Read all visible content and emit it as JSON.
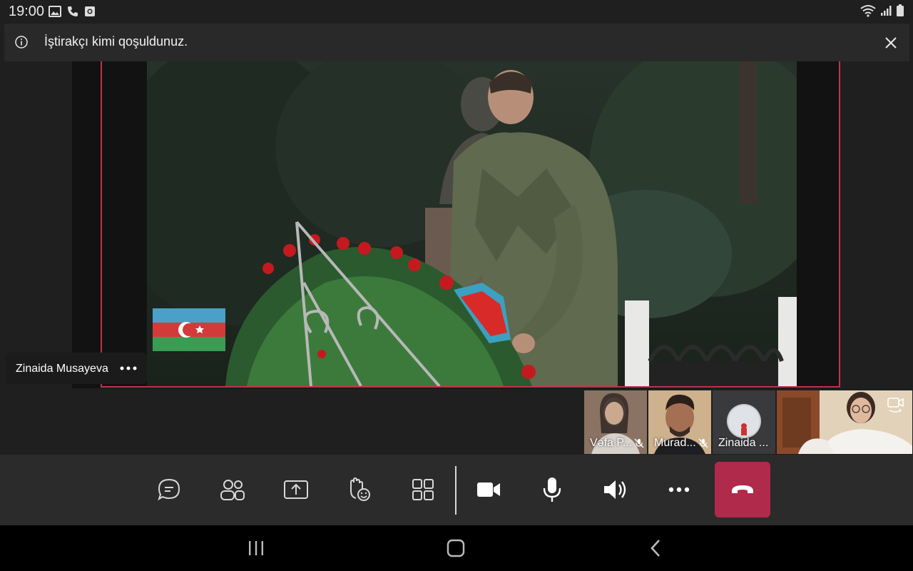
{
  "status_bar": {
    "time": "19:00",
    "left_icons": [
      "image-icon",
      "phone-icon",
      "screen-record-icon"
    ],
    "right_icons": [
      "wifi-icon",
      "signal-icon",
      "battery-icon"
    ]
  },
  "banner": {
    "text": "İştirakçı kimi qoşuldunuz.",
    "info_icon": "info-icon",
    "close_icon": "close-icon"
  },
  "main_video": {
    "presenter_name": "Zinaida Musayeva",
    "more_icon": "more-options-icon"
  },
  "participants": [
    {
      "label": "Vəfa P...",
      "muted": true
    },
    {
      "label": "Murad...",
      "muted": true
    },
    {
      "label": "Zinaida ...",
      "muted": false
    },
    {
      "label": "",
      "is_self": true,
      "switch_camera_icon": "switch-camera-icon"
    }
  ],
  "toolbar": {
    "buttons": [
      "chat-icon",
      "people-icon",
      "share-icon",
      "reactions-icon",
      "view-icon",
      "camera-icon",
      "microphone-icon",
      "speaker-icon",
      "more-icon",
      "hang-up-icon"
    ],
    "leave_color": "#b02a4b"
  },
  "nav_bar": [
    "recent-apps-icon",
    "home-icon",
    "back-icon"
  ],
  "colors": {
    "highlight_border": "#c4314b",
    "background": "#1f1f1f",
    "toolbar": "#2b2b2b"
  }
}
